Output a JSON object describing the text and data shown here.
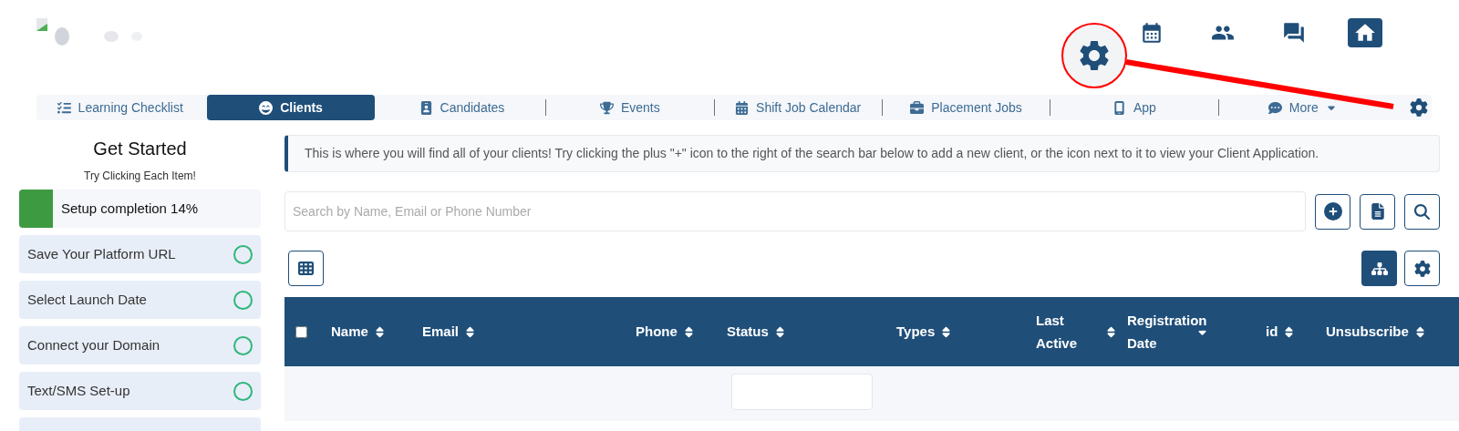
{
  "top_icons": [
    {
      "kind": "calendar",
      "selected": false
    },
    {
      "kind": "people",
      "selected": false
    },
    {
      "kind": "chat",
      "selected": false
    },
    {
      "kind": "home",
      "selected": true
    }
  ],
  "tabs": [
    {
      "label": "Learning Checklist",
      "selected": false
    },
    {
      "label": "Clients",
      "selected": true
    },
    {
      "label": "Candidates",
      "selected": false
    },
    {
      "label": "Events",
      "selected": false
    },
    {
      "label": "Shift Job Calendar",
      "selected": false
    },
    {
      "label": "Placement Jobs",
      "selected": false
    },
    {
      "label": "App",
      "selected": false
    },
    {
      "label": "More",
      "selected": false
    }
  ],
  "sidebar": {
    "title": "Get Started",
    "subtitle": "Try Clicking Each Item!",
    "progress": {
      "label": "Setup completion 14%",
      "level": 0.14
    },
    "items": [
      {
        "label": "Save Your Platform URL",
        "done": false
      },
      {
        "label": "Select Launch Date",
        "done": false
      },
      {
        "label": "Connect your Domain",
        "done": false
      },
      {
        "label": "Text/SMS Set-up",
        "done": false
      }
    ]
  },
  "info": "This is where you will find all of your clients! Try clicking the plus \"+\" icon to the right of the search bar below to add a new client, or the icon next to it to view your Client Application.",
  "search": {
    "placeholder": "Search by Name, Email or Phone Number"
  },
  "table": {
    "columns": [
      {
        "label": "Name",
        "sorted": false
      },
      {
        "label": "Email",
        "sorted": false
      },
      {
        "label": "Phone",
        "sorted": false
      },
      {
        "label": "Status",
        "sorted": false
      },
      {
        "label": "Types",
        "sorted": false
      },
      {
        "label": "Last Active",
        "sorted": false
      },
      {
        "label": "Registration Date",
        "sorted": true
      },
      {
        "label": "id",
        "sorted": false
      },
      {
        "label": "Unsubscribe",
        "sorted": false
      }
    ],
    "select_all": false
  }
}
